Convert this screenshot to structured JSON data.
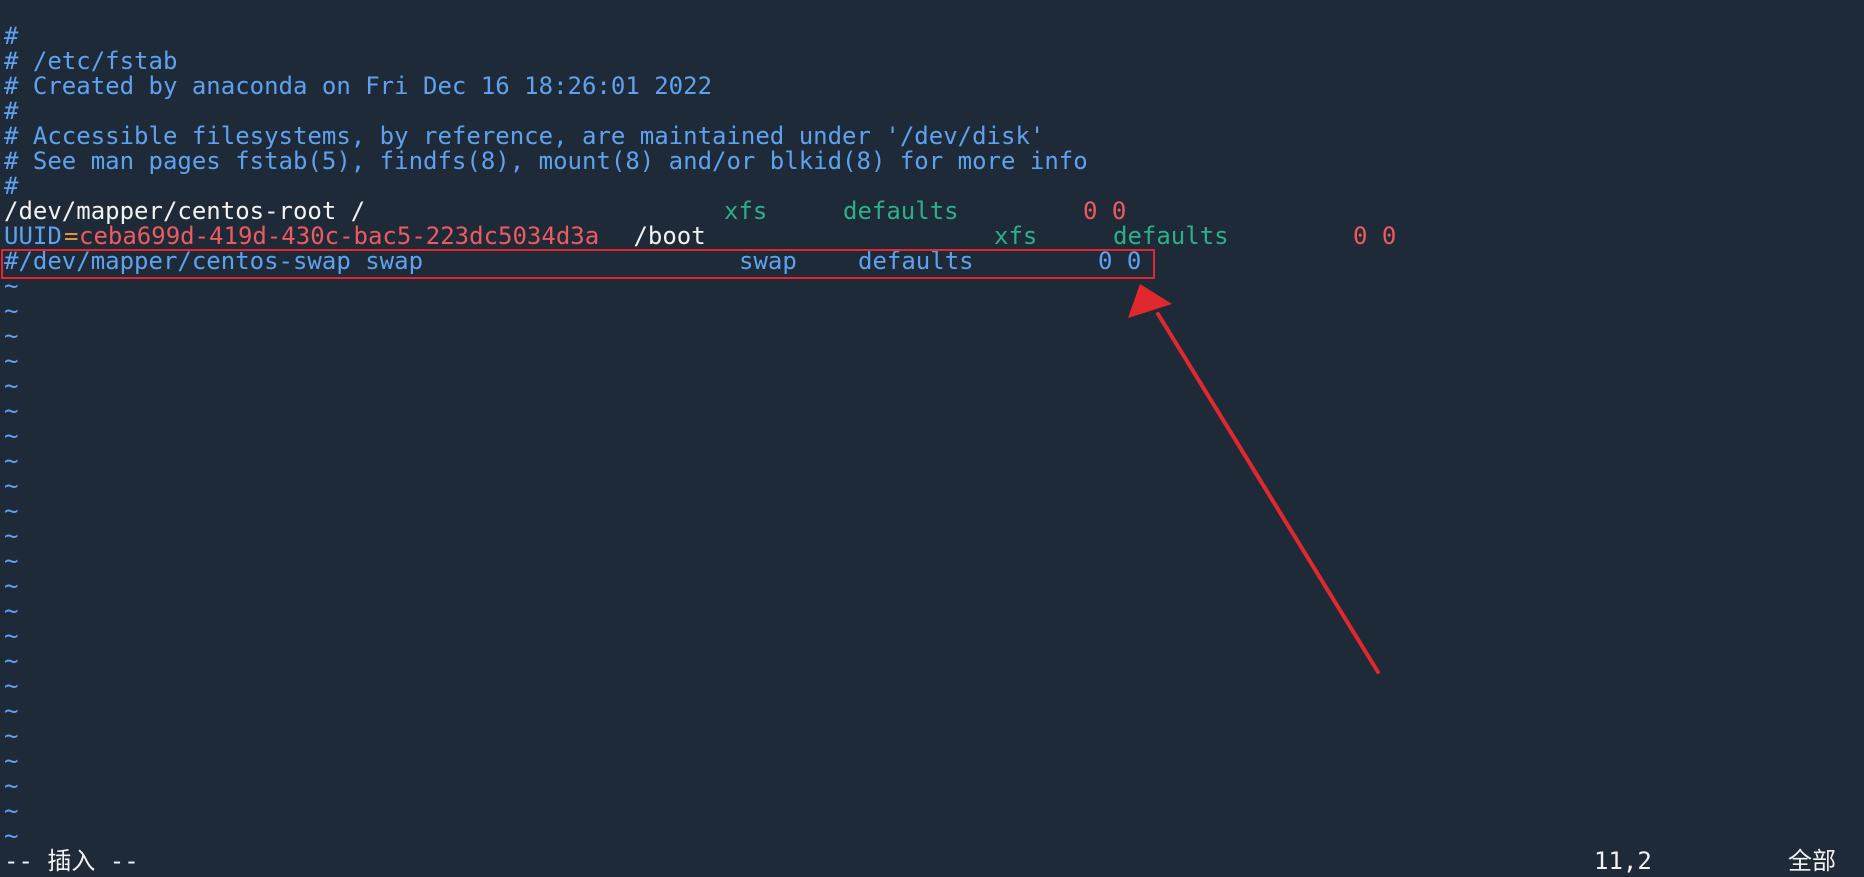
{
  "editor": {
    "lines": {
      "l1": "#",
      "l2": "# /etc/fstab",
      "l3": "# Created by anaconda on Fri Dec 16 18:26:01 2022",
      "l4": "#",
      "l5": "# Accessible filesystems, by reference, are maintained under '/dev/disk'",
      "l6": "# See man pages fstab(5), findfs(8), mount(8) and/or blkid(8) for more info",
      "l7": "#"
    },
    "root_entry": {
      "device": "/dev/mapper/centos-root /",
      "fstype": "xfs",
      "options": "defaults",
      "dump_pass": "0 0"
    },
    "boot_entry": {
      "uuid_key": "UUID",
      "equals": "=",
      "uuid_value": "ceba699d-419d-430c-bac5-223dc5034d3a",
      "mount": " /boot",
      "fstype": "xfs",
      "options": "defaults",
      "dump_pass": "0 0"
    },
    "swap_entry": {
      "device": "#/dev/mapper/centos-swap swap",
      "fstype": "swap",
      "options": "defaults",
      "dump_pass": "0 0"
    },
    "tilde": "~"
  },
  "statusbar": {
    "mode": "-- 插入 --",
    "position": "11,2",
    "scroll": "全部"
  },
  "colors": {
    "background": "#1f2a38",
    "comment": "#5ea2ef",
    "keyword": "#2bb08a",
    "number": "#ef5a5f",
    "annotation": "#e0282e"
  }
}
